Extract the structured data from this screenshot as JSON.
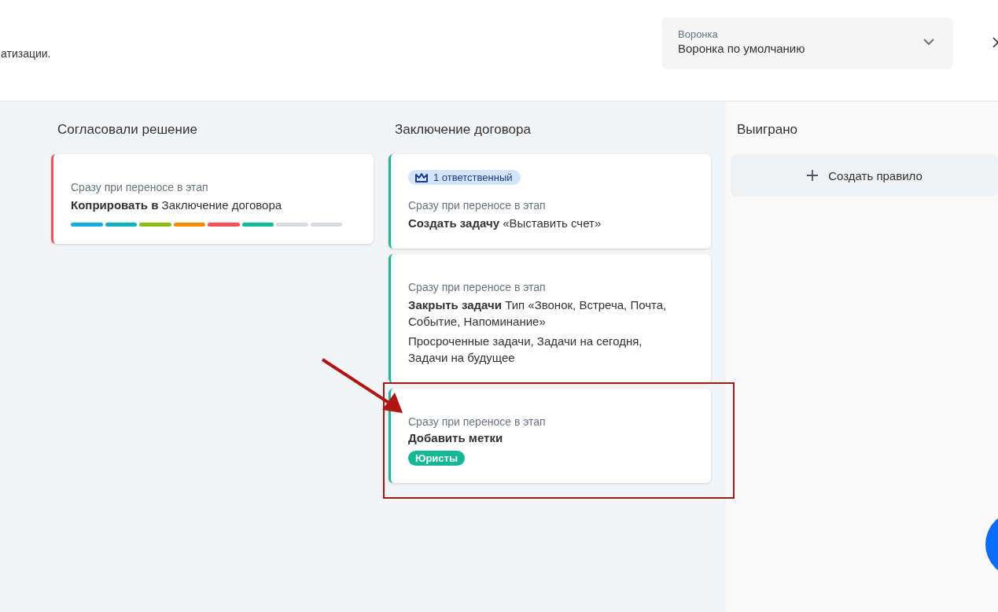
{
  "header": {
    "description": "атизации.",
    "funnel_select": {
      "label": "Воронка",
      "value": "Воронка по умолчанию"
    }
  },
  "columns": [
    {
      "title": "Согласовали решение",
      "kind": "stage",
      "cards": [
        {
          "color": "#f0525a",
          "trigger": "Сразу при переносе в этап",
          "action": "**Коприровать в** Заключение договора",
          "segments": [
            {
              "color": "#11b0e0"
            },
            {
              "color": "#0fb0c0"
            },
            {
              "color": "#8cbc12"
            },
            {
              "color": "#ff8a00"
            },
            {
              "color": "#f65156"
            },
            {
              "color": "#12bc96"
            },
            {
              "color": "#d9dce0"
            },
            {
              "color": "#d9dce0"
            }
          ]
        }
      ]
    },
    {
      "title": "Заключение договора",
      "kind": "stage",
      "cards": [
        {
          "color": "#1fb89a",
          "badge": "1 ответственный",
          "trigger": "Сразу при переносе в этап",
          "action": "**Создать задачу** «Выставить счет»"
        },
        {
          "color": "#1fb89a",
          "trigger": "Сразу при переносе в этап",
          "action": "**Закрыть задачи** Тип «Звонок, Встреча, Почта, Событие, Напоминание»",
          "details": "Просроченные задачи, Задачи на сегодня, Задачи на будущее"
        },
        {
          "color": "#1fb89a",
          "trigger": "Сразу при переносе в этап",
          "title": "Добавить метки",
          "tags": [
            "Юристы"
          ],
          "highlighted": true
        }
      ]
    },
    {
      "title": "Выиграно",
      "kind": "final",
      "create_button": "Создать правило"
    }
  ]
}
